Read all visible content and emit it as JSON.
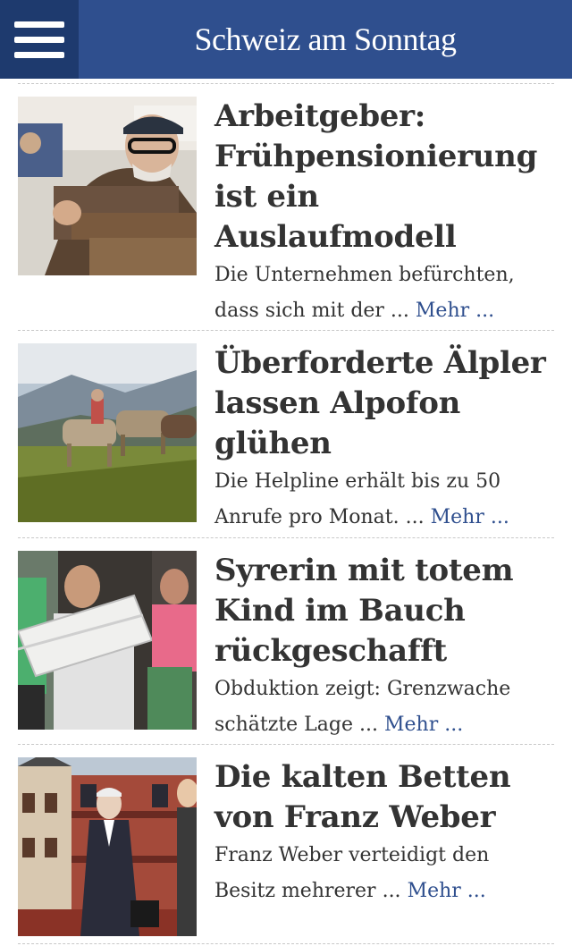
{
  "header": {
    "title": "Schweiz am Sonntag",
    "menu_icon": "hamburger-menu-icon",
    "color": "#2f4f8e"
  },
  "articles": [
    {
      "headline": "Arbeitgeber: Frühpensionierung ist ein Auslaufmodell",
      "teaser": "Die Unternehmen befürchten, dass sich mit der ...",
      "more": "Mehr ...",
      "image": "photo-elderly-worker"
    },
    {
      "headline": "Überforderte Älpler lassen Alpofon glühen",
      "teaser": "Die Helpline erhält bis zu 50 Anrufe pro Monat. ...",
      "more": "Mehr ...",
      "image": "photo-alpine-cows"
    },
    {
      "headline": "Syrerin mit totem Kind im Bauch rückgeschafft",
      "teaser": "Obduktion zeigt: Grenzwache schätzte Lage ...",
      "more": "Mehr ...",
      "image": "photo-men-carrying-box"
    },
    {
      "headline": "Die kalten Betten von Franz Weber",
      "teaser": "Franz Weber verteidigt den Besitz mehrerer ...",
      "more": "Mehr ...",
      "image": "photo-franz-weber-hotel"
    }
  ]
}
